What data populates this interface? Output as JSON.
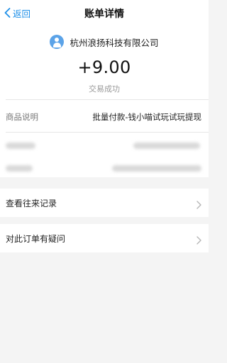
{
  "navbar": {
    "back_label": "返回",
    "title": "账单详情"
  },
  "merchant": {
    "name": "杭州浪扬科技有限公司"
  },
  "transaction": {
    "amount": "+9.00",
    "status": "交易成功"
  },
  "details": [
    {
      "label": "商品说明",
      "value": "批量付款-钱小喵试玩试玩提现"
    }
  ],
  "actions": [
    {
      "label": "查看往来记录"
    },
    {
      "label": "对此订单有疑问"
    }
  ],
  "colors": {
    "accent": "#1d8fe8",
    "avatar": "#5ba3e8",
    "background": "#f4f4f4"
  }
}
